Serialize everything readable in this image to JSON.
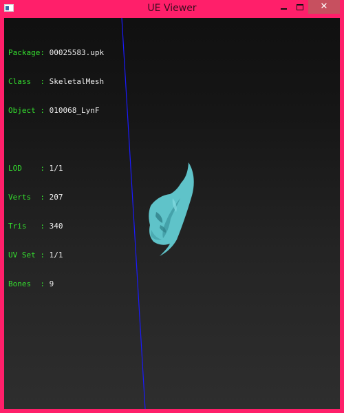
{
  "window": {
    "title": "UE Viewer",
    "close_label": "✕"
  },
  "info": {
    "mesh": [
      {
        "label": "Package: ",
        "value": "00025583.upk"
      },
      {
        "label": "Class  : ",
        "value": "SkeletalMesh"
      },
      {
        "label": "Object : ",
        "value": "010068_LynF"
      }
    ],
    "stats": [
      {
        "label": "LOD    : ",
        "value": "1/1"
      },
      {
        "label": "Verts  : ",
        "value": "207"
      },
      {
        "label": "Tris   : ",
        "value": "340"
      },
      {
        "label": "UV Set : ",
        "value": "1/1"
      },
      {
        "label": "Bones  : ",
        "value": "9"
      }
    ]
  },
  "colors": {
    "frame": "#ff1f6a",
    "label": "#35e02f",
    "value": "#f0f0f0",
    "axis": "#1a1aff",
    "mesh": "#5fc3c9"
  }
}
